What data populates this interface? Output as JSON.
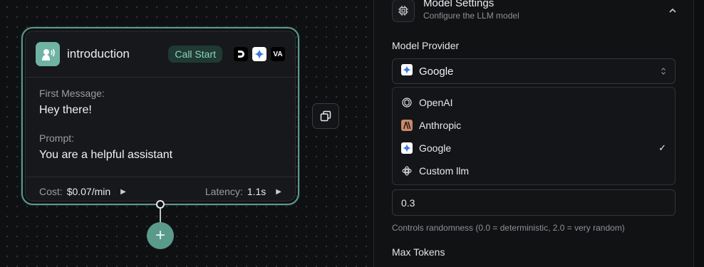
{
  "node": {
    "title": "introduction",
    "badge": "Call Start",
    "provider_icons": [
      {
        "name": "deepgram-icon",
        "text": "D"
      },
      {
        "name": "gemini-icon",
        "text": ""
      },
      {
        "name": "vapi-icon",
        "text": "VA"
      }
    ],
    "first_message_label": "First Message:",
    "first_message": "Hey there!",
    "prompt_label": "Prompt:",
    "prompt": "You are a helpful assistant",
    "cost_label": "Cost:",
    "cost_value": "$0.07/min",
    "latency_label": "Latency:",
    "latency_value": "1.1s",
    "accent": "#5b9a8c"
  },
  "canvas": {
    "add_symbol": "+"
  },
  "panel": {
    "section_title": "Model Settings",
    "section_subtitle": "Configure the LLM model",
    "provider_label": "Model Provider",
    "provider_selected": "Google",
    "provider_options": [
      {
        "label": "OpenAI",
        "icon": "openai-icon",
        "selected": false
      },
      {
        "label": "Anthropic",
        "icon": "anthropic-icon",
        "selected": false
      },
      {
        "label": "Google",
        "icon": "gemini-icon",
        "selected": true
      },
      {
        "label": "Custom llm",
        "icon": "custom-llm-icon",
        "selected": false
      }
    ],
    "check_symbol": "✓",
    "temperature_value": "0.3",
    "temperature_help": "Controls randomness (0.0 = deterministic, 2.0 = very random)",
    "max_tokens_label": "Max Tokens"
  }
}
